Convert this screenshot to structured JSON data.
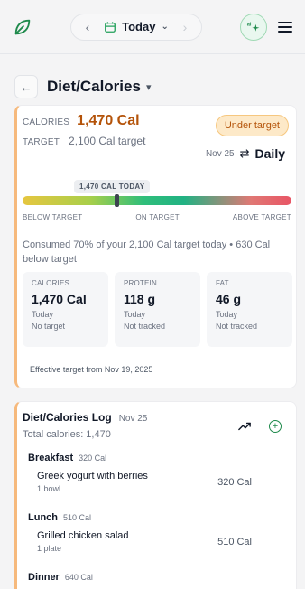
{
  "topbar": {
    "date_label": "Today"
  },
  "page": {
    "title": "Diet/Calories"
  },
  "summary": {
    "calories_label": "CALORIES",
    "calories_value": "1,470 Cal",
    "target_label": "TARGET",
    "target_value": "2,100 Cal target",
    "status_badge": "Under target",
    "period_date": "Nov 25",
    "period_label": "Daily",
    "gauge_tag": "1,470 CAL TODAY",
    "gauge_position": 0.35,
    "gauge_labels": {
      "below": "BELOW TARGET",
      "on": "ON TARGET",
      "above": "ABOVE TARGET"
    },
    "consumed_text": "Consumed 70% of your 2,100 Cal target today • 630 Cal below target",
    "tiles": [
      {
        "title": "CALORIES",
        "value": "1,470 Cal",
        "period": "Today",
        "note": "No target"
      },
      {
        "title": "PROTEIN",
        "value": "118 g",
        "period": "Today",
        "note": "Not tracked"
      },
      {
        "title": "FAT",
        "value": "46 g",
        "period": "Today",
        "note": "Not tracked"
      }
    ],
    "effective_note": "Effective target from Nov 19, 2025"
  },
  "log": {
    "title": "Diet/Calories Log",
    "date": "Nov 25",
    "total": "Total calories: 1,470",
    "meals": [
      {
        "name": "Breakfast",
        "calories": "320 Cal",
        "items": [
          {
            "name": "Greek yogurt with berries",
            "qty": "1 bowl",
            "calories": "320 Cal"
          }
        ]
      },
      {
        "name": "Lunch",
        "calories": "510 Cal",
        "items": [
          {
            "name": "Grilled chicken salad",
            "qty": "1 plate",
            "calories": "510 Cal"
          }
        ]
      },
      {
        "name": "Dinner",
        "calories": "640 Cal",
        "items": []
      }
    ]
  },
  "colors": {
    "accent_green": "#1f8a4c",
    "warning_orange": "#b45309",
    "card_border": "#f6b97c"
  }
}
